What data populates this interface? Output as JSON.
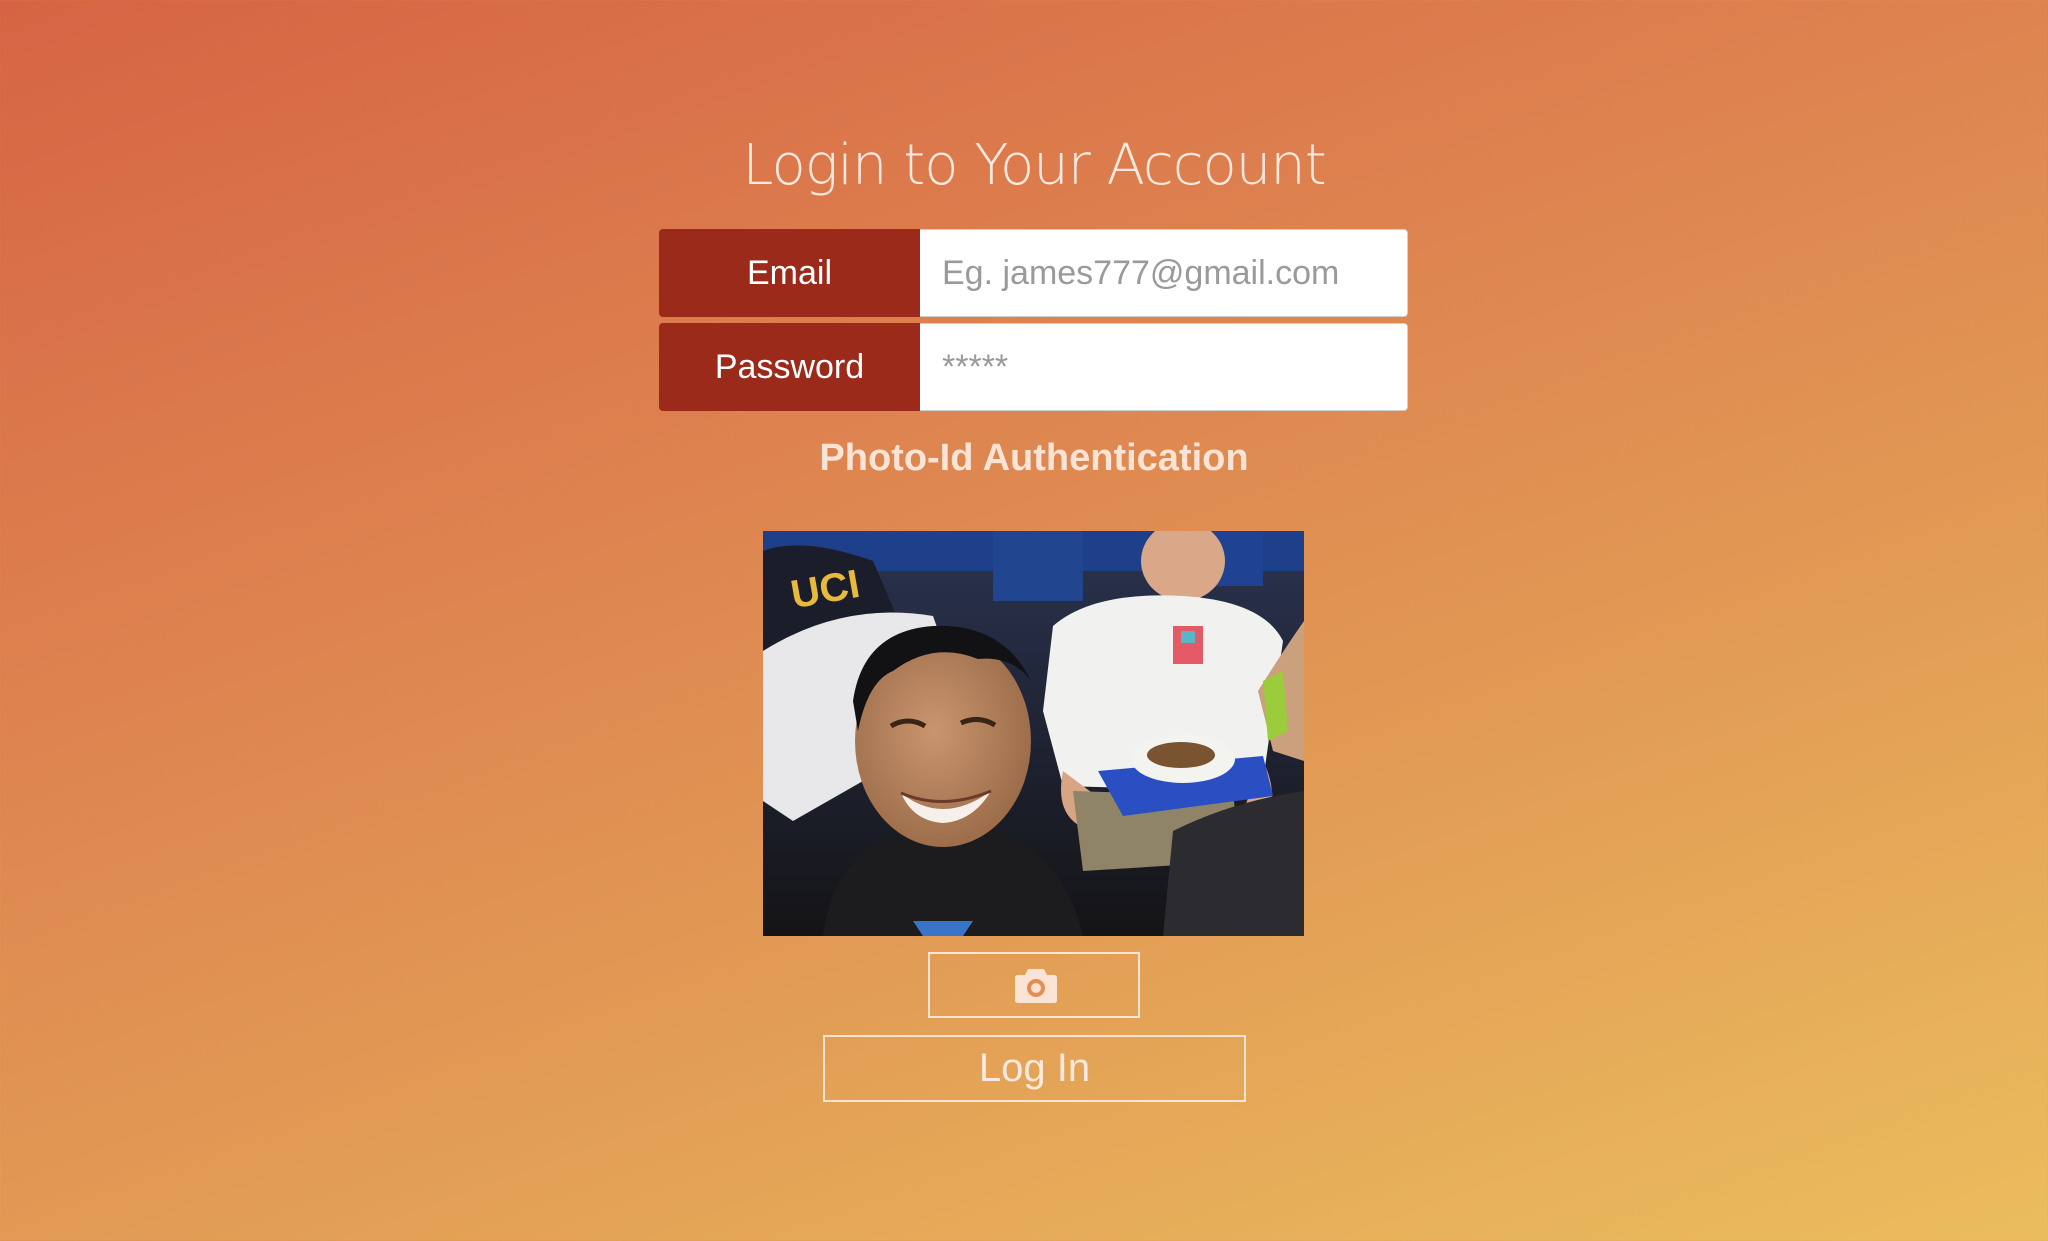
{
  "page": {
    "title": "Login to Your Account"
  },
  "form": {
    "email": {
      "label": "Email",
      "placeholder": "Eg. james777@gmail.com",
      "value": ""
    },
    "password": {
      "label": "Password",
      "placeholder": "*****",
      "value": ""
    }
  },
  "photo_auth": {
    "heading": "Photo-Id Authentication",
    "photo_subject": "captured selfie photo",
    "camera_icon": "camera-icon"
  },
  "actions": {
    "login_label": "Log In"
  },
  "colors": {
    "label_bg": "#9b2a1b",
    "outline": "#fbe4d6",
    "gradient_start": "#d66444",
    "gradient_end": "#ebbd5d"
  }
}
